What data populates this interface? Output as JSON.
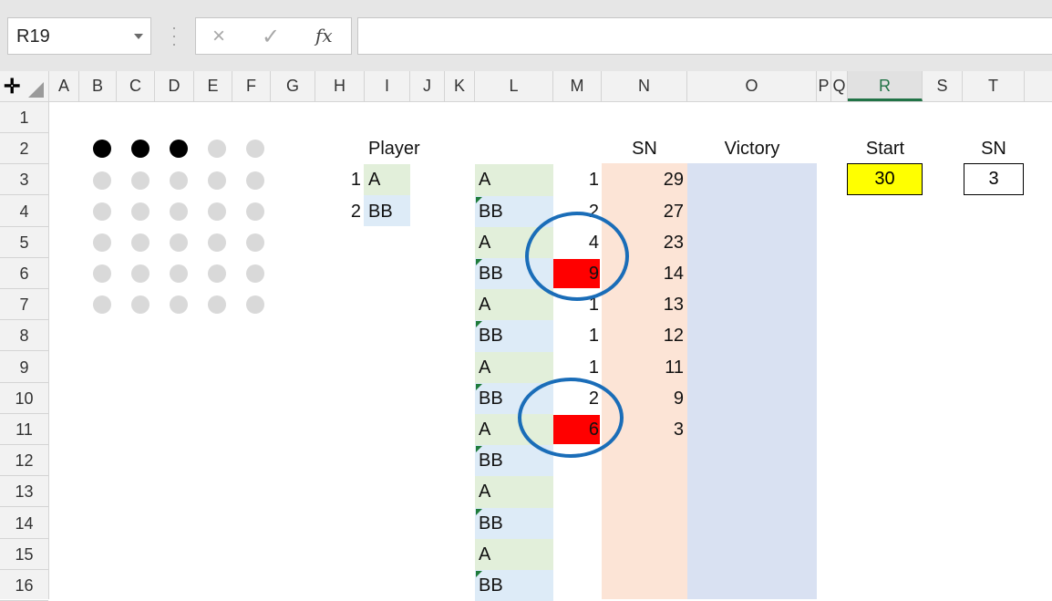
{
  "formula_bar": {
    "name_box": "R19",
    "cancel_icon": "×",
    "enter_icon": "✓",
    "fx_label": "fx",
    "formula": ""
  },
  "columns": [
    "A",
    "B",
    "C",
    "D",
    "E",
    "F",
    "G",
    "H",
    "I",
    "J",
    "K",
    "L",
    "M",
    "N",
    "O",
    "P",
    "Q",
    "R",
    "S",
    "T"
  ],
  "active_column": "R",
  "rows": [
    "1",
    "2",
    "3",
    "4",
    "5",
    "6",
    "7",
    "8",
    "9",
    "10",
    "11",
    "12",
    "13",
    "14",
    "15",
    "16"
  ],
  "dot_grid": {
    "rows": [
      [
        "black",
        "black",
        "black",
        "gray",
        "gray"
      ],
      [
        "gray",
        "gray",
        "gray",
        "gray",
        "gray"
      ],
      [
        "gray",
        "gray",
        "gray",
        "gray",
        "gray"
      ],
      [
        "gray",
        "gray",
        "gray",
        "gray",
        "gray"
      ],
      [
        "gray",
        "gray",
        "gray",
        "gray",
        "gray"
      ],
      [
        "gray",
        "gray",
        "gray",
        "gray",
        "gray"
      ]
    ]
  },
  "players": {
    "header": "Player",
    "list": [
      {
        "num": "1",
        "name": "A"
      },
      {
        "num": "2",
        "name": "BB"
      }
    ]
  },
  "headers": {
    "sn": "SN",
    "victory": "Victory",
    "start": "Start",
    "sn2": "SN"
  },
  "start_value": "30",
  "sn_value": "3",
  "turns": [
    {
      "player": "A",
      "move": "1",
      "remaining": "29",
      "highlight": false
    },
    {
      "player": "BB",
      "move": "2",
      "remaining": "27",
      "highlight": false
    },
    {
      "player": "A",
      "move": "4",
      "remaining": "23",
      "highlight": false
    },
    {
      "player": "BB",
      "move": "9",
      "remaining": "14",
      "highlight": true
    },
    {
      "player": "A",
      "move": "1",
      "remaining": "13",
      "highlight": false
    },
    {
      "player": "BB",
      "move": "1",
      "remaining": "12",
      "highlight": false
    },
    {
      "player": "A",
      "move": "1",
      "remaining": "11",
      "highlight": false
    },
    {
      "player": "BB",
      "move": "2",
      "remaining": "9",
      "highlight": false
    },
    {
      "player": "A",
      "move": "6",
      "remaining": "3",
      "highlight": true
    },
    {
      "player": "BB",
      "move": "",
      "remaining": "",
      "highlight": false
    },
    {
      "player": "A",
      "move": "",
      "remaining": "",
      "highlight": false
    },
    {
      "player": "BB",
      "move": "",
      "remaining": "",
      "highlight": false
    },
    {
      "player": "A",
      "move": "",
      "remaining": "",
      "highlight": false
    },
    {
      "player": "BB",
      "move": "",
      "remaining": "",
      "highlight": false
    }
  ],
  "colors": {
    "green_fill": "#e2efda",
    "blue_fill": "#ddebf7",
    "sn_fill": "#fce4d6",
    "victory_fill": "#d9e1f2",
    "start_fill": "#ffff00",
    "highlight_red": "#ff0000",
    "circle_blue": "#1a6db8",
    "accent_green": "#217346"
  }
}
